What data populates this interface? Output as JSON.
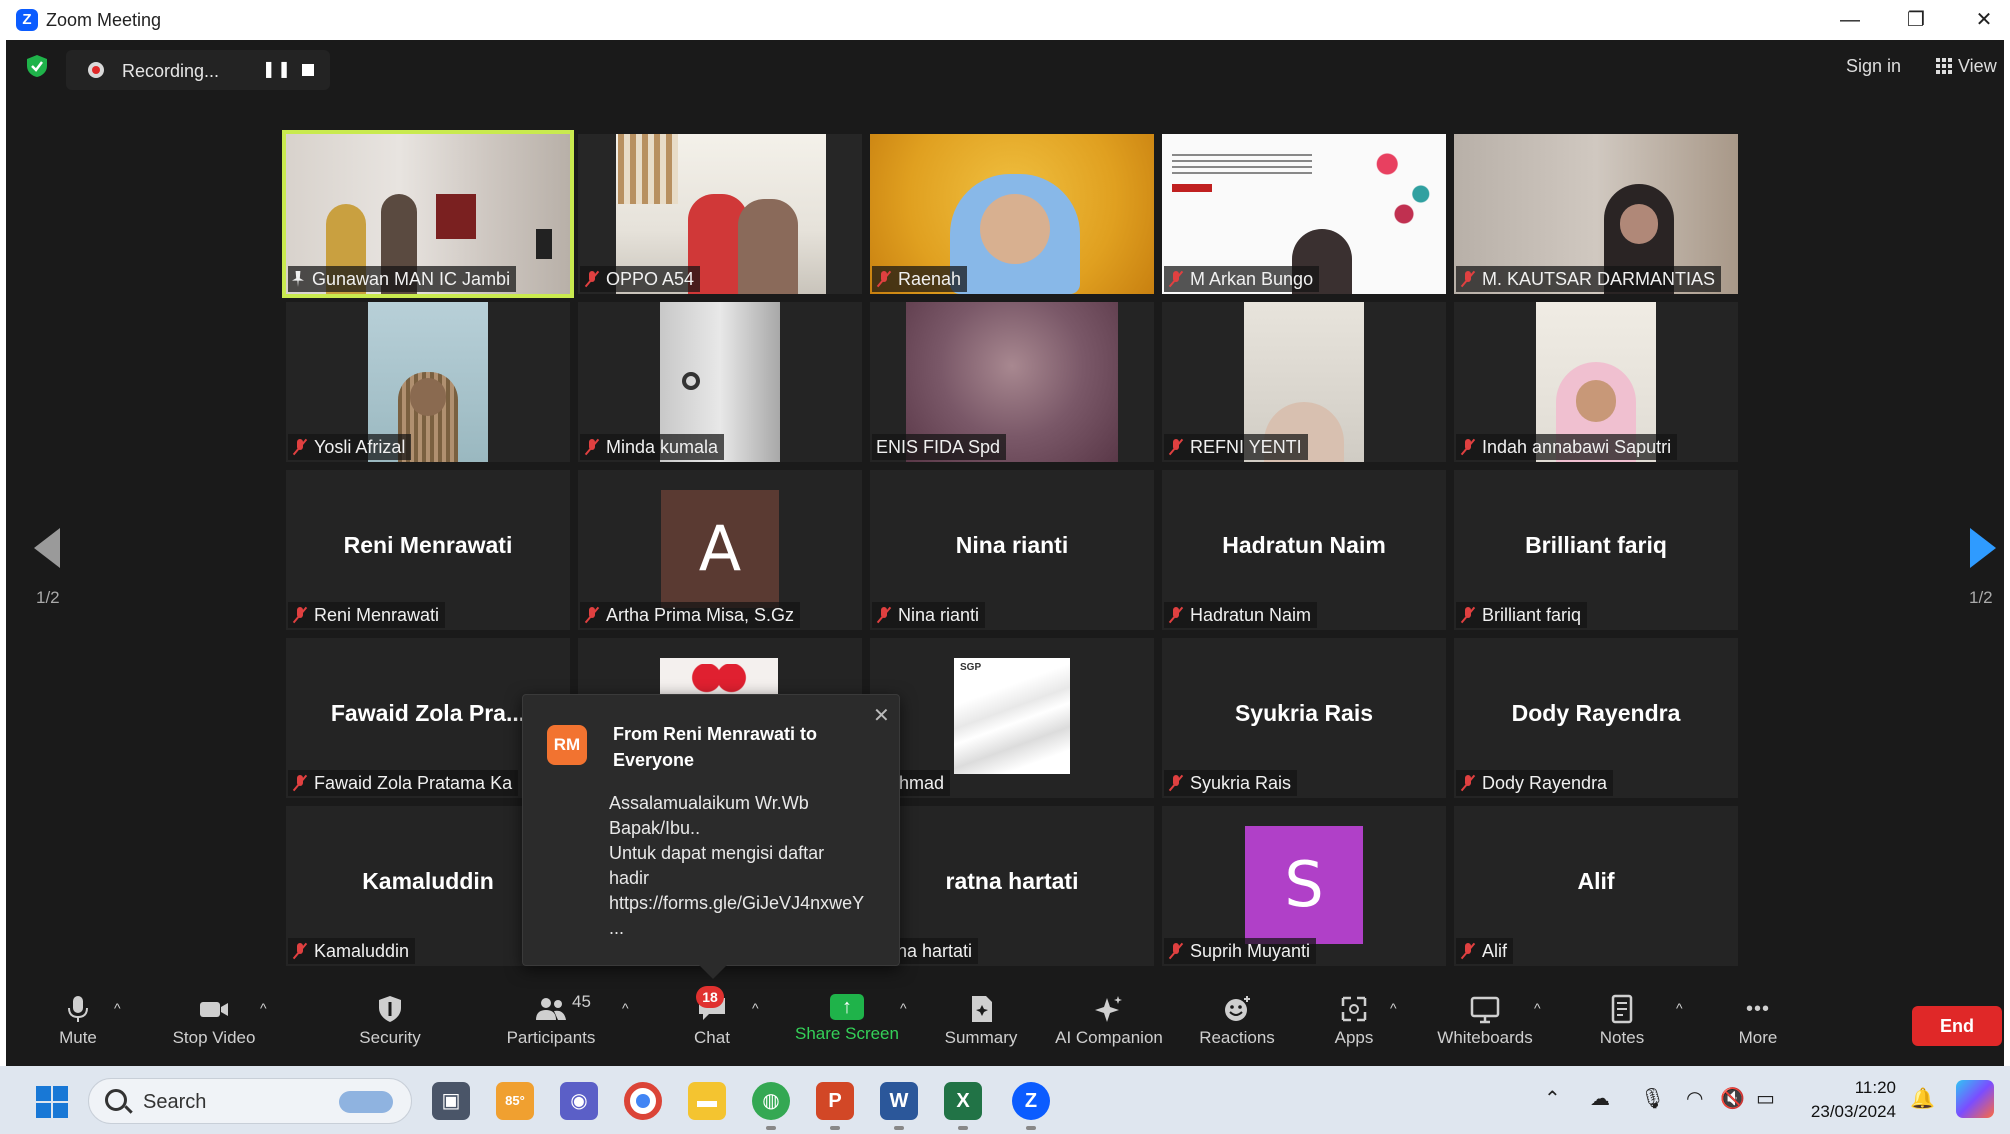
{
  "window": {
    "title": "Zoom Meeting",
    "minimize": "—",
    "restore": "❐",
    "close": "✕"
  },
  "topbar": {
    "recording_label": "Recording...",
    "pause_glyph": "❚❚",
    "sign_in": "Sign in",
    "view": "View"
  },
  "pagination": {
    "left": "1/2",
    "right": "1/2"
  },
  "tiles": [
    {
      "label": "Gunawan MAN IC Jambi",
      "big": ""
    },
    {
      "label": "OPPO A54",
      "big": ""
    },
    {
      "label": "Raenah",
      "big": ""
    },
    {
      "label": "M Arkan Bungo",
      "big": ""
    },
    {
      "label": "M. KAUTSAR DARMANTIAS",
      "big": ""
    },
    {
      "label": "Yosli Afrizal",
      "big": ""
    },
    {
      "label": "Minda kumala",
      "big": ""
    },
    {
      "label": "ENIS FIDA Spd",
      "big": ""
    },
    {
      "label": "REFNI YENTI",
      "big": ""
    },
    {
      "label": "Indah annabawi Saputri",
      "big": ""
    },
    {
      "label": "Reni Menrawati",
      "big": "Reni Menrawati"
    },
    {
      "label": "Artha Prima Misa, S.Gz",
      "big": "",
      "avatar": "A"
    },
    {
      "label": "Nina rianti",
      "big": "Nina rianti"
    },
    {
      "label": "Hadratun Naim",
      "big": "Hadratun Naim"
    },
    {
      "label": "Brilliant fariq",
      "big": "Brilliant fariq"
    },
    {
      "label": "Fawaid Zola Pratama Ka",
      "big": "Fawaid Zola Pra..."
    },
    {
      "label": "",
      "big": ""
    },
    {
      "label": "Rahmad",
      "big": "",
      "logo": "SGP"
    },
    {
      "label": "Syukria Rais",
      "big": "Syukria Rais"
    },
    {
      "label": "Dody Rayendra",
      "big": "Dody Rayendra"
    },
    {
      "label": "Kamaluddin",
      "big": "Kamaluddin"
    },
    {
      "label": "",
      "big": ""
    },
    {
      "label": "ratna hartati",
      "big": "ratna hartati"
    },
    {
      "label": "Suprih Muyanti",
      "big": "",
      "avatar": "S"
    },
    {
      "label": "Alif",
      "big": "Alif"
    }
  ],
  "chat_popup": {
    "initials": "RM",
    "from": "From Reni Menrawati to Everyone",
    "close": "✕",
    "lines": [
      "Assalamualaikum Wr.Wb",
      "Bapak/Ibu..",
      "Untuk dapat mengisi daftar",
      "hadir",
      "https://forms.gle/GiJeVJ4nxweY",
      "..."
    ]
  },
  "toolbar": {
    "mute": "Mute",
    "stop_video": "Stop Video",
    "security": "Security",
    "participants": "Participants",
    "participants_count": "45",
    "chat": "Chat",
    "chat_badge": "18",
    "share_screen": "Share Screen",
    "summary": "Summary",
    "ai_companion": "AI Companion",
    "reactions": "Reactions",
    "apps": "Apps",
    "whiteboards": "Whiteboards",
    "notes": "Notes",
    "more": "More",
    "more_glyph": "•••",
    "end": "End",
    "caret": "^"
  },
  "taskbar": {
    "search": "Search",
    "weather_temp": "85°",
    "time": "11:20",
    "date": "23/03/2024"
  },
  "colors": {
    "accent_active_speaker": "#c9ea4f",
    "share_green": "#1fb34a",
    "end_red": "#e02828",
    "mute_red": "#e04040"
  }
}
